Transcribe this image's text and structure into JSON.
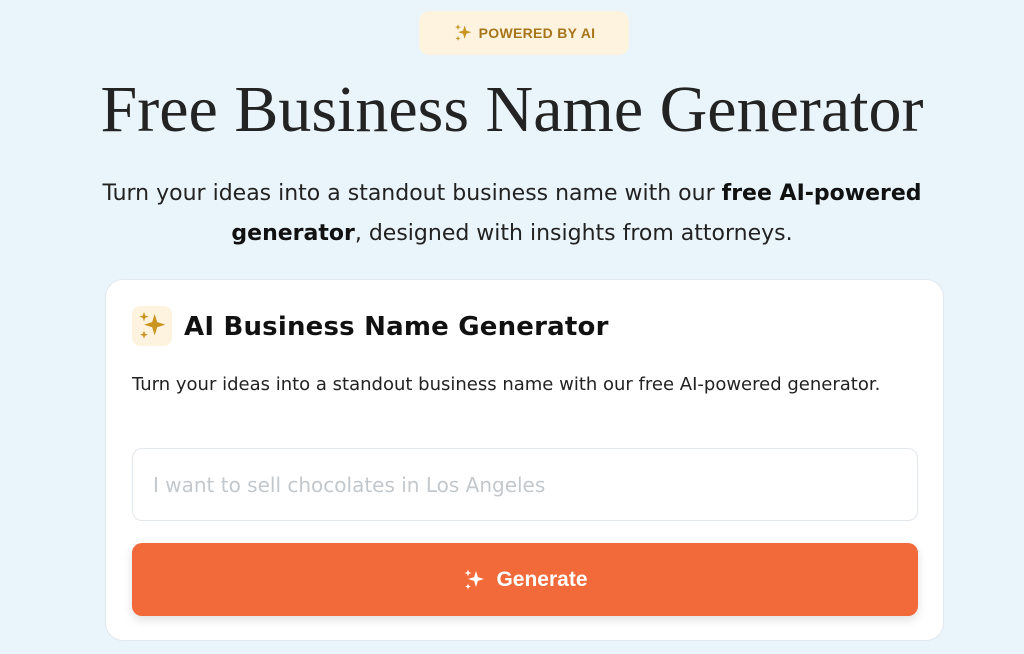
{
  "badge": {
    "icon": "sparkles-icon",
    "label": "POWERED BY AI",
    "color": "#a7751a",
    "background": "#fdf3df"
  },
  "hero": {
    "title": "Free Business Name Generator",
    "subtitle_before": "Turn your ideas into a standout business name with our ",
    "subtitle_bold": "free AI-powered generator",
    "subtitle_after": ", designed with insights from attorneys."
  },
  "generator": {
    "icon": "sparkles-icon",
    "title": "AI Business Name Generator",
    "description": "Turn your ideas into a standout business name with our free AI-powered generator.",
    "input": {
      "value": "",
      "placeholder": "I want to sell chocolates in Los Angeles"
    },
    "button": {
      "icon": "sparkles-icon",
      "label": "Generate",
      "color": "#f2693a"
    }
  },
  "colors": {
    "page_background": "#eaf5fb",
    "accent_gold": "#c9941f"
  }
}
